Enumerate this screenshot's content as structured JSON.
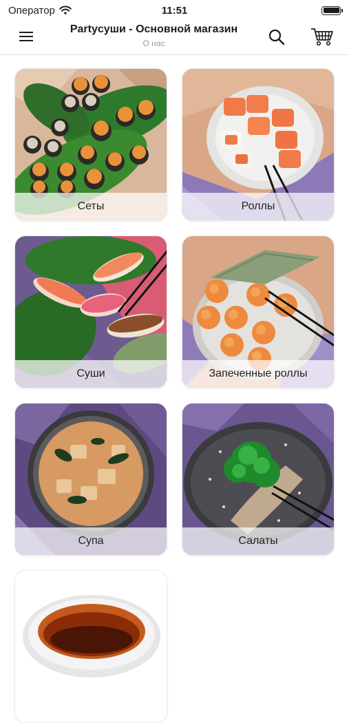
{
  "status": {
    "carrier": "Оператор",
    "time": "11:51",
    "battery_level": 1.0
  },
  "header": {
    "title": "Partyсуши - Основной магазин",
    "subtitle": "О нас"
  },
  "icons": {
    "menu": "hamburger-menu-icon",
    "search": "search-icon",
    "cart": "shopping-cart-icon"
  },
  "categories": [
    {
      "label": "Сеты"
    },
    {
      "label": "Роллы"
    },
    {
      "label": "Суши"
    },
    {
      "label": "Запеченные роллы"
    },
    {
      "label": "Супа"
    },
    {
      "label": "Салаты"
    },
    {
      "label": ""
    }
  ],
  "colors": {
    "accent": "#1c1c1e",
    "divider": "#e2e2e4",
    "subtitle": "#9a9a9e"
  }
}
